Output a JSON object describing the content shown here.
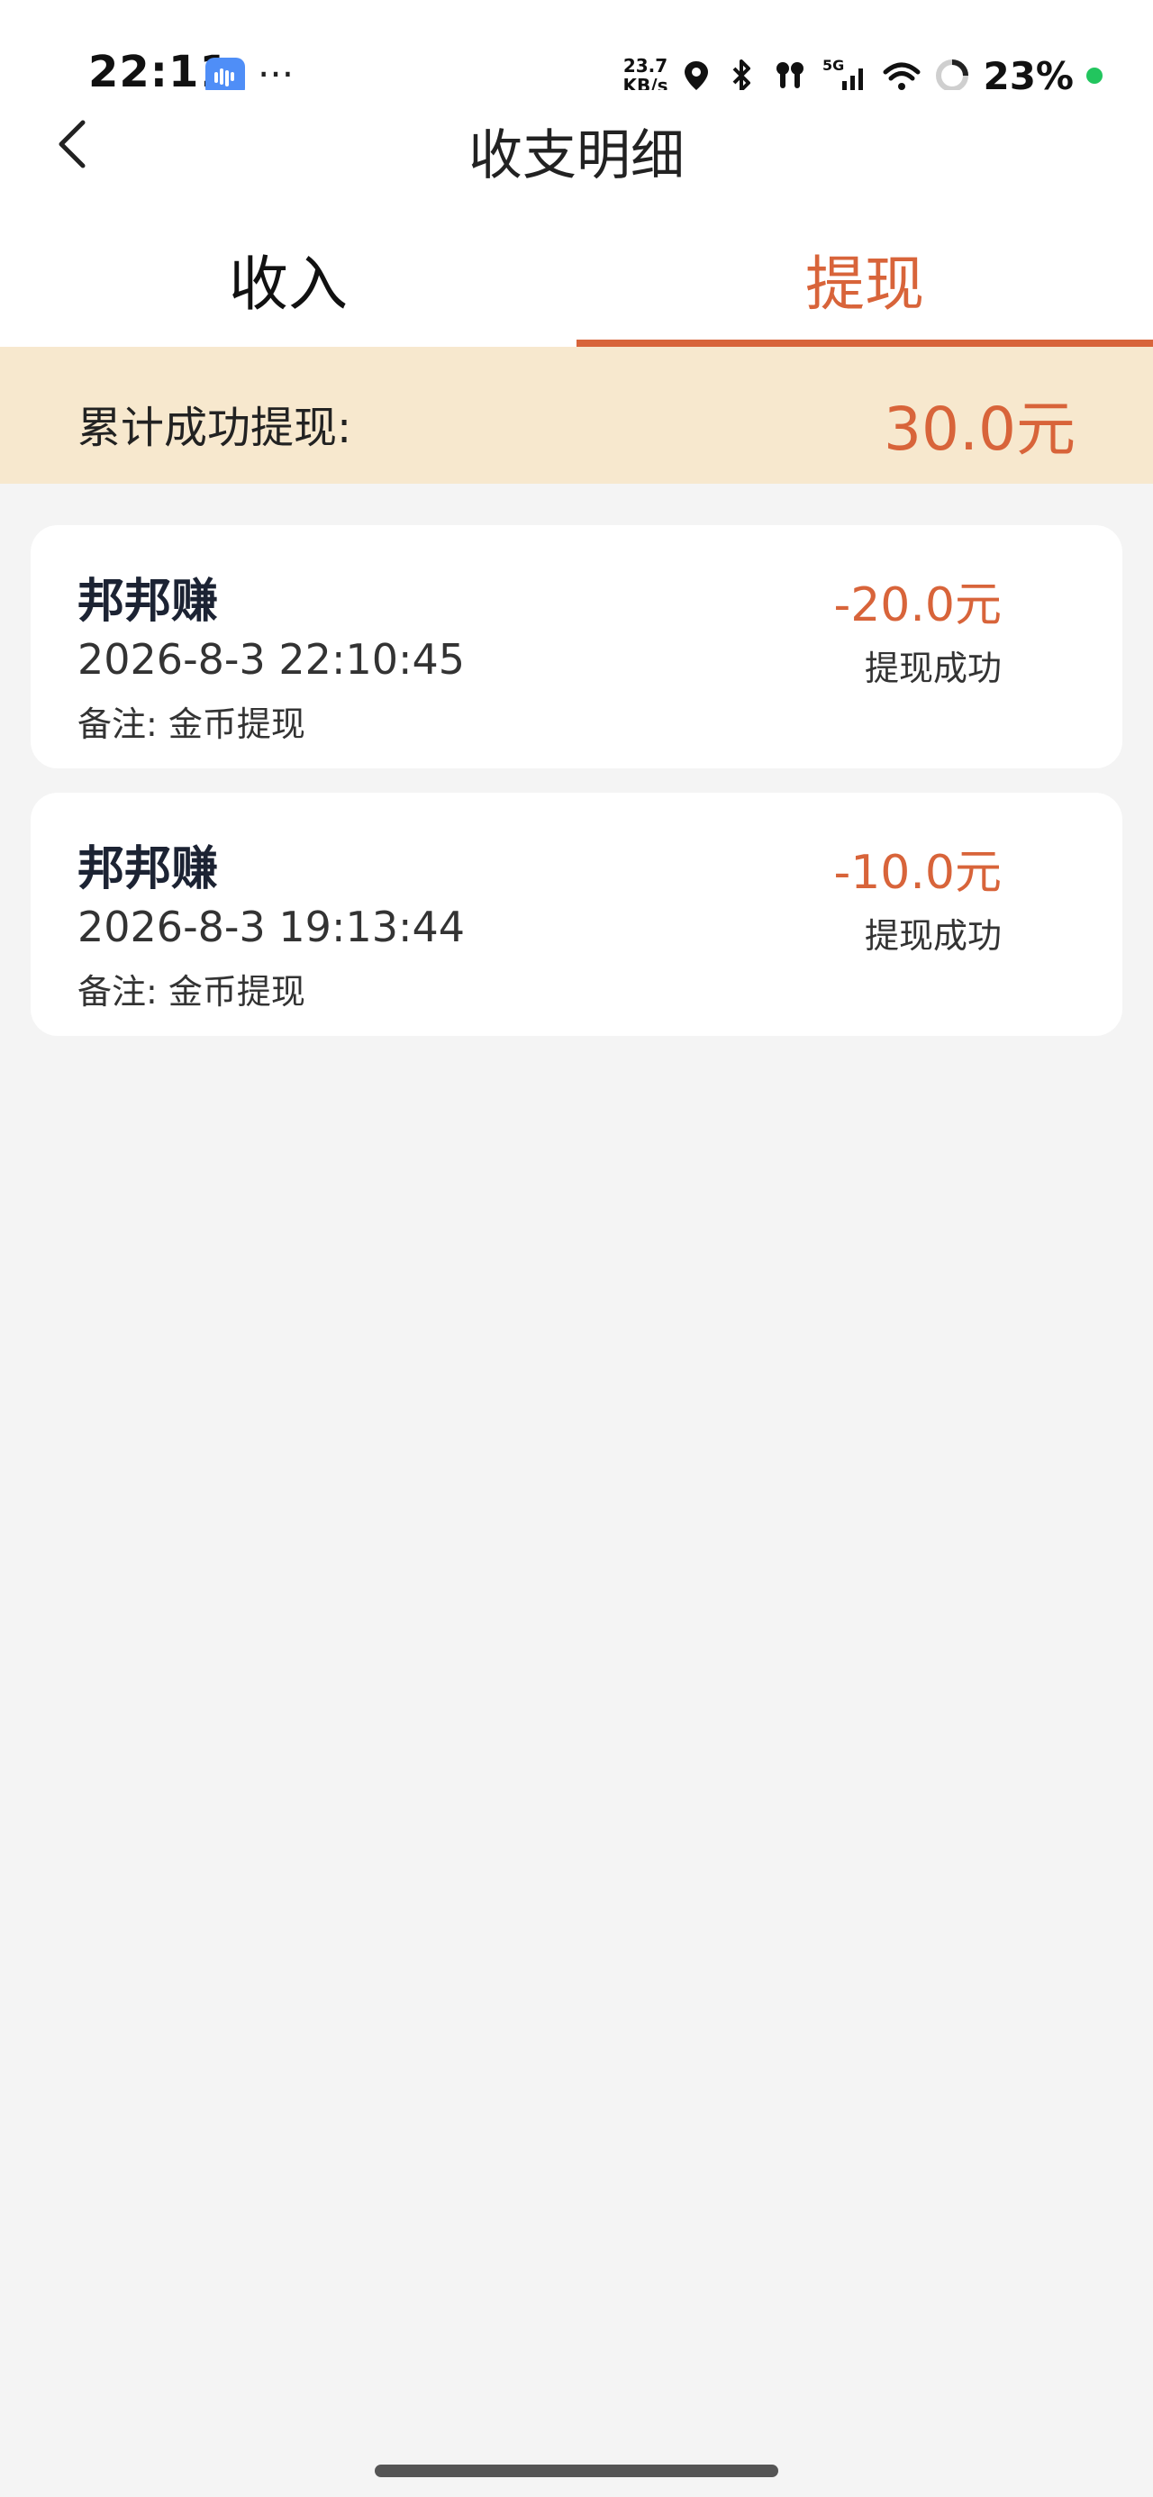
{
  "status_bar": {
    "time": "22:11",
    "more": "···",
    "net_speed_value": "23.7",
    "net_speed_unit": "KB/s",
    "network": "5G",
    "battery": "23%",
    "icons": [
      "app-notification-icon",
      "location-icon",
      "bluetooth-icon",
      "earbuds-icon",
      "signal-icon",
      "wifi-icon",
      "loading-icon"
    ]
  },
  "header": {
    "title": "收支明细",
    "back_icon": "chevron-left-icon"
  },
  "tabs": [
    {
      "label": "收入",
      "active": false
    },
    {
      "label": "提现",
      "active": true
    }
  ],
  "summary": {
    "label": "累计成功提现:",
    "amount": "30.0元"
  },
  "records": [
    {
      "source": "邦邦赚",
      "time": "2026-8-3 22:10:45",
      "remark": "备注: 金币提现",
      "amount": "-20.0元",
      "status": "提现成功"
    },
    {
      "source": "邦邦赚",
      "time": "2026-8-3 19:13:44",
      "remark": "备注: 金币提现",
      "amount": "-10.0元",
      "status": "提现成功"
    }
  ],
  "colors": {
    "accent": "#d8643a",
    "summary_bg": "#f7e8ce",
    "page_bg": "#f4f4f4",
    "card_bg": "#ffffff"
  }
}
